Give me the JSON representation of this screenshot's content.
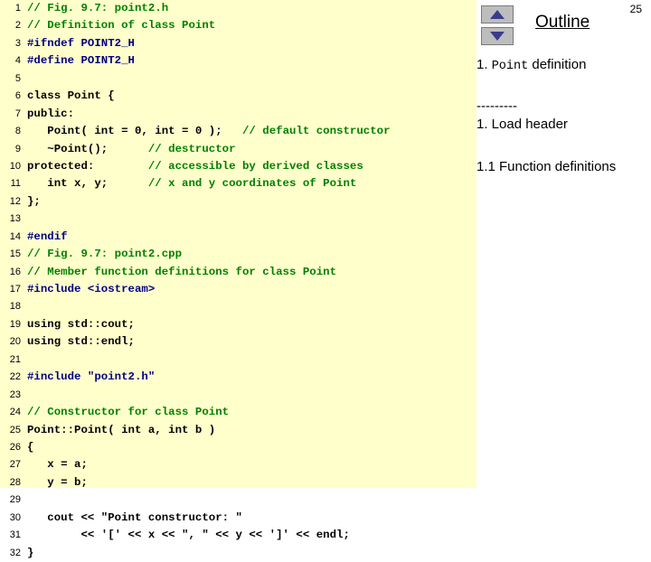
{
  "page_number": "25",
  "code": {
    "lines": [
      {
        "n": "1",
        "segments": [
          {
            "t": "// Fig. 9.7: point2.h",
            "c": "cmt"
          }
        ]
      },
      {
        "n": "2",
        "segments": [
          {
            "t": "// Definition of class Point",
            "c": "cmt"
          }
        ]
      },
      {
        "n": "3",
        "segments": [
          {
            "t": "#ifndef POINT2_H",
            "c": "pp"
          }
        ]
      },
      {
        "n": "4",
        "segments": [
          {
            "t": "#define POINT2_H",
            "c": "pp"
          }
        ]
      },
      {
        "n": "5",
        "segments": []
      },
      {
        "n": "6",
        "segments": [
          {
            "t": "class Point {",
            "c": "code"
          }
        ]
      },
      {
        "n": "7",
        "segments": [
          {
            "t": "public:",
            "c": "code"
          }
        ]
      },
      {
        "n": "8",
        "segments": [
          {
            "t": "   Point( int = 0, int = 0 );   ",
            "c": "code"
          },
          {
            "t": "// default constructor",
            "c": "cmt"
          }
        ]
      },
      {
        "n": "9",
        "segments": [
          {
            "t": "   ~Point();      ",
            "c": "code"
          },
          {
            "t": "// destructor",
            "c": "cmt"
          }
        ]
      },
      {
        "n": "10",
        "segments": [
          {
            "t": "protected:        ",
            "c": "code"
          },
          {
            "t": "// accessible by derived classes",
            "c": "cmt"
          }
        ]
      },
      {
        "n": "11",
        "segments": [
          {
            "t": "   int x, y;      ",
            "c": "code"
          },
          {
            "t": "// x and y coordinates of Point",
            "c": "cmt"
          }
        ]
      },
      {
        "n": "12",
        "segments": [
          {
            "t": "};",
            "c": "code"
          }
        ]
      },
      {
        "n": "13",
        "segments": []
      },
      {
        "n": "14",
        "segments": [
          {
            "t": "#endif",
            "c": "pp"
          }
        ]
      },
      {
        "n": "15",
        "segments": [
          {
            "t": "// Fig. 9.7: point2.cpp",
            "c": "cmt"
          }
        ]
      },
      {
        "n": "16",
        "segments": [
          {
            "t": "// Member function definitions for class Point",
            "c": "cmt"
          }
        ]
      },
      {
        "n": "17",
        "segments": [
          {
            "t": "#include <iostream>",
            "c": "pp"
          }
        ]
      },
      {
        "n": "18",
        "segments": []
      },
      {
        "n": "19",
        "segments": [
          {
            "t": "using std::cout;",
            "c": "code"
          }
        ]
      },
      {
        "n": "20",
        "segments": [
          {
            "t": "using std::endl;",
            "c": "code"
          }
        ]
      },
      {
        "n": "21",
        "segments": []
      },
      {
        "n": "22",
        "segments": [
          {
            "t": "#include \"point2.h\"",
            "c": "pp"
          }
        ]
      },
      {
        "n": "23",
        "segments": []
      },
      {
        "n": "24",
        "segments": [
          {
            "t": "// Constructor for class Point",
            "c": "cmt"
          }
        ]
      },
      {
        "n": "25",
        "segments": [
          {
            "t": "Point::Point( int a, int b )",
            "c": "code"
          }
        ]
      },
      {
        "n": "26",
        "segments": [
          {
            "t": "{",
            "c": "code"
          }
        ]
      },
      {
        "n": "27",
        "segments": [
          {
            "t": "   x = a;",
            "c": "code"
          }
        ]
      },
      {
        "n": "28",
        "segments": [
          {
            "t": "   y = b;",
            "c": "code"
          }
        ]
      },
      {
        "n": "29",
        "segments": []
      },
      {
        "n": "30",
        "segments": [
          {
            "t": "   cout << \"Point constructor: \"",
            "c": "code"
          }
        ]
      },
      {
        "n": "31",
        "segments": [
          {
            "t": "        << '[' << x << \", \" << y << ']' << endl;",
            "c": "code"
          }
        ]
      },
      {
        "n": "32",
        "segments": [
          {
            "t": "}",
            "c": "code"
          }
        ]
      }
    ]
  },
  "outline": {
    "title": "Outline",
    "scroll_up_icon": "triangle-up-icon",
    "scroll_down_icon": "triangle-down-icon",
    "items": [
      {
        "prefix": "1. ",
        "mono": "Point",
        "suffix": " definition"
      },
      {
        "prefix": "",
        "mono": "",
        "suffix": "---------"
      },
      {
        "prefix": "1. Load header",
        "mono": "",
        "suffix": ""
      },
      {
        "prefix": "1.1 Function definitions",
        "mono": "",
        "suffix": ""
      }
    ]
  }
}
